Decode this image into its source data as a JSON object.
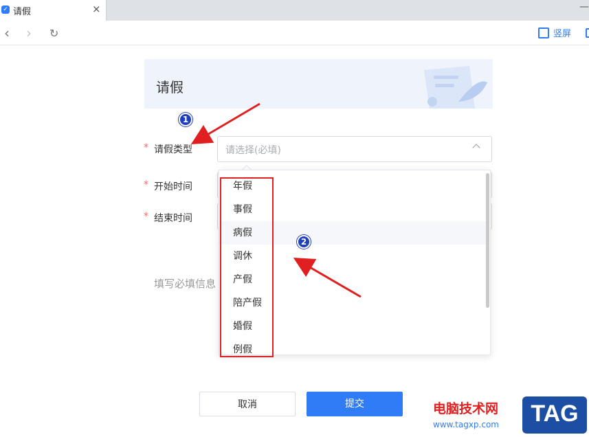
{
  "tab": {
    "title": "请假",
    "close": "×"
  },
  "window": {
    "minimize": "—"
  },
  "nav": {
    "back": "‹",
    "forward": "›",
    "reload": "↻",
    "vertical_screen": "竖屏"
  },
  "banner": {
    "title": "请假"
  },
  "form": {
    "fields": [
      {
        "label": "请假类型",
        "required": "*"
      },
      {
        "label": "开始时间",
        "required": "*"
      },
      {
        "label": "结束时间",
        "required": "*"
      }
    ],
    "select_placeholder": "请选择(必填)",
    "hint": "填写必填信息"
  },
  "dropdown": {
    "options": [
      "年假",
      "事假",
      "病假",
      "调休",
      "产假",
      "陪产假",
      "婚假",
      "例假"
    ],
    "hovered": "病假"
  },
  "annotations": {
    "badge1": "1",
    "badge2": "2"
  },
  "buttons": {
    "cancel": "取消",
    "submit": "提交"
  },
  "watermark": {
    "site": "电脑技术网",
    "url": "www.tagxp.com",
    "logo": "TAG"
  },
  "colors": {
    "accent": "#2f7cf6",
    "required": "#f56c6c",
    "annotation": "#e02020",
    "badge": "#1f3fbf"
  },
  "icons": {
    "tab": "checkmark-icon",
    "vertical_screen": "vertical-screen-icon",
    "banner": "document-feather-icon"
  }
}
